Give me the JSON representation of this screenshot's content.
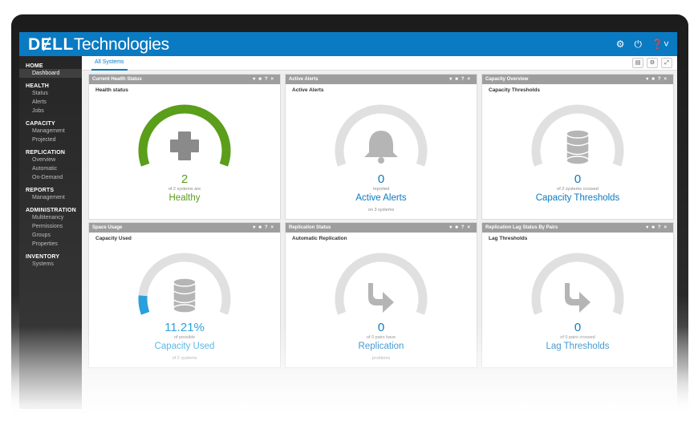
{
  "brand": {
    "bold": "DɆLL",
    "rest": "Technologies"
  },
  "top_icons": [
    "gear-icon",
    "power-icon",
    "help-icon"
  ],
  "colors": {
    "topbar": "#0a7ac2",
    "accent_blue": "#0a7ac2",
    "healthy_green": "#5a9e1a",
    "gauge_track": "#e0e0e0",
    "used_blue": "#2aa0dc"
  },
  "sidebar": {
    "sections": [
      {
        "title": "HOME",
        "items": [
          "Dashboard"
        ]
      },
      {
        "title": "HEALTH",
        "items": [
          "Status",
          "Alerts",
          "Jobs"
        ]
      },
      {
        "title": "CAPACITY",
        "items": [
          "Management",
          "Projected"
        ]
      },
      {
        "title": "REPLICATION",
        "items": [
          "Overview",
          "Automatic",
          "On-Demand"
        ]
      },
      {
        "title": "REPORTS",
        "items": [
          "Management"
        ]
      },
      {
        "title": "ADMINISTRATION",
        "items": [
          "Multitenancy",
          "Permissions",
          "Groups",
          "Properties"
        ]
      },
      {
        "title": "INVENTORY",
        "items": [
          "Systems"
        ]
      }
    ],
    "active_item": "Dashboard"
  },
  "tabs": [
    {
      "label": "All Systems",
      "active": true
    }
  ],
  "widgets": [
    {
      "header": "Current Health Status",
      "subtitle": "Health status",
      "value": "2",
      "desc": "of 2 systems are",
      "title": "Healthy",
      "footer": "",
      "icon": "plus-icon",
      "color": "#5a9e1a",
      "fill": 1.0
    },
    {
      "header": "Active Alerts",
      "subtitle": "Active Alerts",
      "value": "0",
      "desc": "reported",
      "title": "Active Alerts",
      "footer": "on 3 systems",
      "icon": "bell-icon",
      "color": "#0a7ac2",
      "fill": 0
    },
    {
      "header": "Capacity Overview",
      "subtitle": "Capacity Thresholds",
      "value": "0",
      "desc": "of 2 systems crossed",
      "title": "Capacity Thresholds",
      "footer": "",
      "icon": "database-icon",
      "color": "#0a7ac2",
      "fill": 0
    },
    {
      "header": "Space Usage",
      "subtitle": "Capacity Used",
      "value": "11.21%",
      "desc": "of possible",
      "title": "Capacity Used",
      "footer": "of 2 systems",
      "icon": "database-icon",
      "color": "#2aa0dc",
      "fill": 0.1121
    },
    {
      "header": "Replication Status",
      "subtitle": "Automatic Replication",
      "value": "0",
      "desc": "of 0 pairs have",
      "title": "Replication",
      "footer": "problems",
      "icon": "arrow-icon",
      "color": "#0a7ac2",
      "fill": 0
    },
    {
      "header": "Replication Lag Status By Pairs",
      "subtitle": "Lag Thresholds",
      "value": "0",
      "desc": "of 0 pairs crossed",
      "title": "Lag Thresholds",
      "footer": "",
      "icon": "arrow-icon",
      "color": "#0a7ac2",
      "fill": 0
    }
  ]
}
